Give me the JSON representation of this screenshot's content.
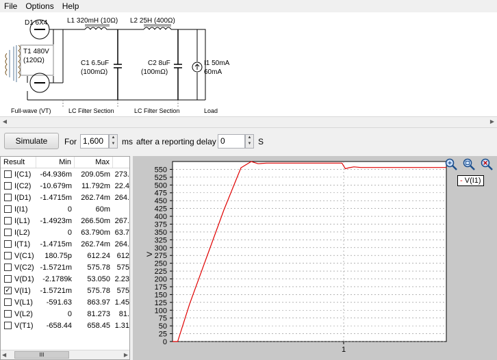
{
  "menu": [
    "File",
    "Options",
    "Help"
  ],
  "schematic": {
    "d1": "D1 6X4",
    "l1": "L1 320mH (10Ω)",
    "l2": "L2 25H (400Ω)",
    "t1_a": "T1 480V",
    "t1_b": "(120Ω)",
    "c1_a": "C1 6.5uF",
    "c1_b": "(100mΩ)",
    "c2_a": "C2 8uF",
    "c2_b": "(100mΩ)",
    "i1_a": "I1 50mA",
    "i1_b": "60mA",
    "sec1": "Full-wave (VT)",
    "sec2": "LC Filter Section",
    "sec3": "LC Filter Section",
    "sec4": "Load"
  },
  "sim": {
    "button": "Simulate",
    "for_label": "For",
    "duration": "1,600",
    "unit": "ms",
    "delay_label": "after a reporting delay of",
    "delay": "0",
    "delay_unit": "S"
  },
  "results": {
    "headers": [
      "Result",
      "Min",
      "Max"
    ],
    "rows": [
      {
        "name": "I(C1)",
        "min": "-64.936m",
        "max": "209.05m",
        "ext": "273.",
        "checked": false
      },
      {
        "name": "I(C2)",
        "min": "-10.679m",
        "max": "11.792m",
        "ext": "22.4",
        "checked": false
      },
      {
        "name": "I(D1)",
        "min": "-1.4715m",
        "max": "262.74m",
        "ext": "264.",
        "checked": false
      },
      {
        "name": "I(I1)",
        "min": "0",
        "max": "60m",
        "ext": "",
        "checked": false
      },
      {
        "name": "I(L1)",
        "min": "-1.4923m",
        "max": "266.50m",
        "ext": "267.",
        "checked": false
      },
      {
        "name": "I(L2)",
        "min": "0",
        "max": "63.790m",
        "ext": "63.7",
        "checked": false
      },
      {
        "name": "I(T1)",
        "min": "-1.4715m",
        "max": "262.74m",
        "ext": "264.",
        "checked": false
      },
      {
        "name": "V(C1)",
        "min": "180.75p",
        "max": "612.24",
        "ext": "612",
        "checked": false
      },
      {
        "name": "V(C2)",
        "min": "-1.5721m",
        "max": "575.78",
        "ext": "575",
        "checked": false
      },
      {
        "name": "V(D1)",
        "min": "-2.1789k",
        "max": "53.050",
        "ext": "2.23",
        "checked": false
      },
      {
        "name": "V(I1)",
        "min": "-1.5721m",
        "max": "575.78",
        "ext": "575",
        "checked": true
      },
      {
        "name": "V(L1)",
        "min": "-591.63",
        "max": "863.97",
        "ext": "1.45",
        "checked": false
      },
      {
        "name": "V(L2)",
        "min": "0",
        "max": "81.273",
        "ext": "81.",
        "checked": false
      },
      {
        "name": "V(T1)",
        "min": "-658.44",
        "max": "658.45",
        "ext": "1.31",
        "checked": false
      }
    ],
    "scroll_grip": "III"
  },
  "zoom_icons": [
    "zoom-in-icon",
    "zoom-fit-icon",
    "zoom-out-icon"
  ],
  "colors": {
    "trace": "#e00000",
    "plot_bg": "#ffffff",
    "panel_bg": "#c8c8c8"
  },
  "chart_data": {
    "type": "line",
    "ylabel": "V",
    "xlabel": "",
    "yticks": [
      0,
      25,
      50,
      75,
      100,
      125,
      150,
      175,
      200,
      225,
      250,
      275,
      300,
      325,
      350,
      375,
      400,
      425,
      450,
      475,
      500,
      525,
      550
    ],
    "xtick_labels": [
      "1"
    ],
    "ylim": [
      0,
      575
    ],
    "xlim": [
      0,
      1.6
    ],
    "grid": true,
    "legend": "top-right",
    "series": [
      {
        "name": "V(I1)",
        "x": [
          0,
          0.03,
          0.1,
          0.2,
          0.3,
          0.4,
          0.46,
          0.5,
          0.55,
          0.6,
          0.7,
          0.8,
          0.9,
          0.99,
          1.01,
          1.03,
          1.06,
          1.1,
          1.2,
          1.3,
          1.4,
          1.5,
          1.6
        ],
        "y": [
          0,
          0,
          120,
          270,
          420,
          555,
          575,
          568,
          570,
          570,
          570,
          570,
          570,
          570,
          552,
          555,
          558,
          556,
          556,
          556,
          556,
          556,
          556
        ]
      }
    ]
  }
}
